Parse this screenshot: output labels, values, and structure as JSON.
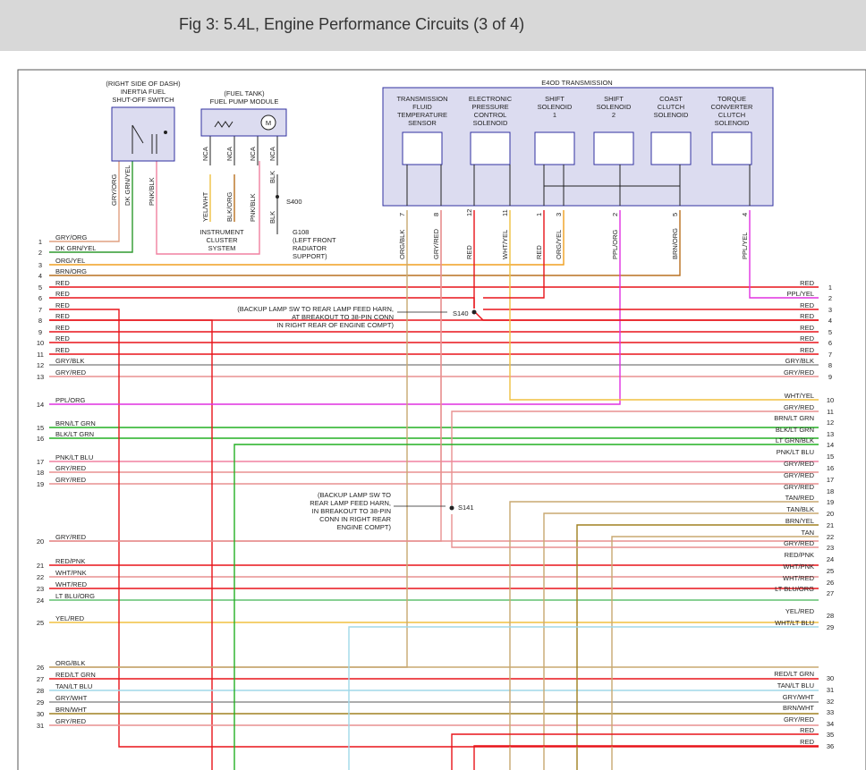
{
  "header": {
    "title": "Fig 3: 5.4L, Engine Performance Circuits (3 of 4)"
  },
  "components": {
    "inertia_switch": [
      "(RIGHT SIDE OF DASH)",
      "INERTIA FUEL",
      "SHUT-OFF SWITCH"
    ],
    "fuel_pump": [
      "(FUEL TANK)",
      "FUEL PUMP MODULE"
    ],
    "fuel_pump_motor": "M",
    "transmission": "E4OD TRANSMISSION",
    "trans_components": [
      [
        "TRANSMISSION",
        "FLUID",
        "TEMPERATURE",
        "SENSOR"
      ],
      [
        "ELECTRONIC",
        "PRESSURE",
        "CONTROL",
        "SOLENOID"
      ],
      [
        "SHIFT",
        "SOLENOID",
        "1"
      ],
      [
        "SHIFT",
        "SOLENOID",
        "2"
      ],
      [
        "COAST",
        "CLUTCH",
        "SOLENOID"
      ],
      [
        "TORQUE",
        "CONVERTER",
        "CLUTCH",
        "SOLENOID"
      ]
    ],
    "instrument_cluster": [
      "INSTRUMENT",
      "CLUSTER",
      "SYSTEM"
    ],
    "g108": [
      "G108",
      "(LEFT FRONT",
      "RADIATOR",
      "SUPPORT)"
    ],
    "s400": "S400",
    "s140": "S140",
    "s141": "S141",
    "s140_note": [
      "(BACKUP LAMP SW TO REAR LAMP FEED HARN,",
      "AT BREAKOUT TO 38-PIN CONN",
      "IN RIGHT REAR OF ENGINE COMPT)"
    ],
    "s141_note": [
      "(BACKUP LAMP SW TO",
      "REAR LAMP FEED HARN,",
      "IN BREAKOUT TO 38-PIN",
      "CONN IN RIGHT REAR",
      "ENGINE COMPT)"
    ]
  },
  "vertical_wire_labels": {
    "inertia": [
      "GRY/ORG",
      "DK GRN/YEL",
      "PNK/BLK"
    ],
    "fuel_pump": [
      "NCA",
      "NCA",
      "NCA",
      "NCA"
    ],
    "fuel_pump_lower": [
      "YEL/WHT",
      "BLK/ORG",
      "PNK/BLK",
      "BLK",
      "BLK"
    ],
    "trans": [
      "ORG/BLK",
      "GRY/RED",
      "RED",
      "WHT/YEL",
      "RED",
      "ORG/YEL",
      "PPL/ORG",
      "BRN/ORG",
      "PPL/YEL"
    ],
    "trans_pins": [
      "7",
      "8",
      "12",
      "11",
      "1",
      "3",
      "2",
      "5",
      "4"
    ]
  },
  "left_connector": [
    {
      "pin": "1",
      "label": "GRY/ORG"
    },
    {
      "pin": "2",
      "label": "DK GRN/YEL"
    },
    {
      "pin": "3",
      "label": "ORG/YEL"
    },
    {
      "pin": "4",
      "label": "BRN/ORG"
    },
    {
      "pin": "5",
      "label": "RED"
    },
    {
      "pin": "6",
      "label": "RED"
    },
    {
      "pin": "7",
      "label": "RED"
    },
    {
      "pin": "8",
      "label": "RED"
    },
    {
      "pin": "9",
      "label": "RED"
    },
    {
      "pin": "10",
      "label": "RED"
    },
    {
      "pin": "11",
      "label": "RED"
    },
    {
      "pin": "12",
      "label": "GRY/BLK"
    },
    {
      "pin": "13",
      "label": "GRY/RED"
    },
    {
      "pin": "14",
      "label": "PPL/ORG"
    },
    {
      "pin": "15",
      "label": "BRN/LT GRN"
    },
    {
      "pin": "16",
      "label": "BLK/LT GRN"
    },
    {
      "pin": "17",
      "label": "PNK/LT BLU"
    },
    {
      "pin": "18",
      "label": "GRY/RED"
    },
    {
      "pin": "19",
      "label": "GRY/RED"
    },
    {
      "pin": "20",
      "label": "GRY/RED"
    },
    {
      "pin": "21",
      "label": "RED/PNK"
    },
    {
      "pin": "22",
      "label": "WHT/PNK"
    },
    {
      "pin": "23",
      "label": "WHT/RED"
    },
    {
      "pin": "24",
      "label": "LT BLU/ORG"
    },
    {
      "pin": "25",
      "label": "YEL/RED"
    },
    {
      "pin": "26",
      "label": "ORG/BLK"
    },
    {
      "pin": "27",
      "label": "RED/LT GRN"
    },
    {
      "pin": "28",
      "label": "TAN/LT BLU"
    },
    {
      "pin": "29",
      "label": "GRY/WHT"
    },
    {
      "pin": "30",
      "label": "BRN/WHT"
    },
    {
      "pin": "31",
      "label": "GRY/RED"
    }
  ],
  "right_connector": [
    {
      "pin": "1",
      "label": "RED"
    },
    {
      "pin": "2",
      "label": "PPL/YEL"
    },
    {
      "pin": "3",
      "label": "RED"
    },
    {
      "pin": "4",
      "label": "RED"
    },
    {
      "pin": "5",
      "label": "RED"
    },
    {
      "pin": "6",
      "label": "RED"
    },
    {
      "pin": "7",
      "label": "RED"
    },
    {
      "pin": "8",
      "label": "GRY/BLK"
    },
    {
      "pin": "9",
      "label": "GRY/RED"
    },
    {
      "pin": "10",
      "label": "WHT/YEL"
    },
    {
      "pin": "11",
      "label": "GRY/RED"
    },
    {
      "pin": "12",
      "label": "BRN/LT GRN"
    },
    {
      "pin": "13",
      "label": "BLK/LT GRN"
    },
    {
      "pin": "14",
      "label": "LT GRN/BLK"
    },
    {
      "pin": "15",
      "label": "PNK/LT BLU"
    },
    {
      "pin": "16",
      "label": "GRY/RED"
    },
    {
      "pin": "17",
      "label": "GRY/RED"
    },
    {
      "pin": "18",
      "label": "GRY/RED"
    },
    {
      "pin": "19",
      "label": "TAN/RED"
    },
    {
      "pin": "20",
      "label": "TAN/BLK"
    },
    {
      "pin": "21",
      "label": "BRN/YEL"
    },
    {
      "pin": "22",
      "label": "TAN"
    },
    {
      "pin": "23",
      "label": "GRY/RED"
    },
    {
      "pin": "24",
      "label": "RED/PNK"
    },
    {
      "pin": "25",
      "label": "WHT/PNK"
    },
    {
      "pin": "26",
      "label": "WHT/RED"
    },
    {
      "pin": "27",
      "label": "LT BLU/ORG"
    },
    {
      "pin": "28",
      "label": "YEL/RED"
    },
    {
      "pin": "29",
      "label": "WHT/LT BLU"
    },
    {
      "pin": "30",
      "label": "RED/LT GRN"
    },
    {
      "pin": "31",
      "label": "TAN/LT BLU"
    },
    {
      "pin": "32",
      "label": "GRY/WHT"
    },
    {
      "pin": "33",
      "label": "BRN/WHT"
    },
    {
      "pin": "34",
      "label": "GRY/RED"
    },
    {
      "pin": "35",
      "label": "RED"
    },
    {
      "pin": "36",
      "label": "RED"
    }
  ],
  "colors": {
    "red": "#e8141a",
    "gry_org": "#e0a080",
    "dk_grn_yel": "#2e9a2e",
    "org_yel": "#f0a020",
    "brn_org": "#b87020",
    "gray": "#909090",
    "gry_red": "#e89090",
    "ppl_org": "#e030e0",
    "green": "#24b024",
    "pnk": "#f080a0",
    "lt_blu_org": "#60c070",
    "yel_red": "#f0c040",
    "lt_blu": "#a0d8e8",
    "tan": "#c8a870",
    "brn": "#a08020",
    "box_fill": "#dcdcf0",
    "box_stroke": "#3030a0"
  }
}
